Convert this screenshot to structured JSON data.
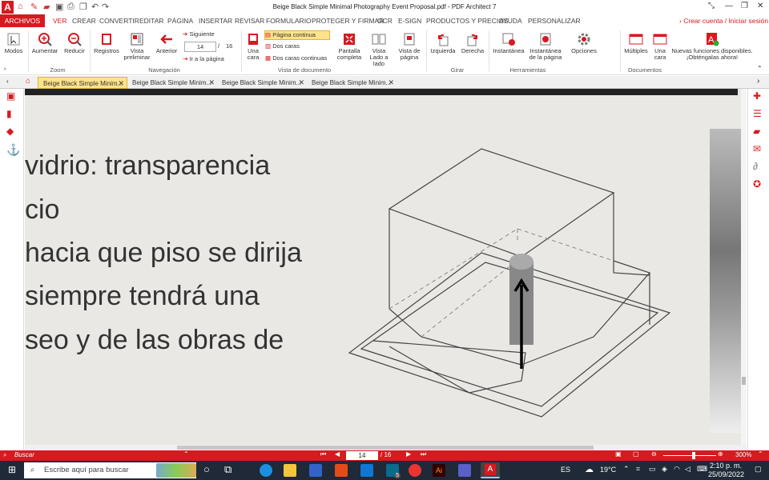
{
  "window": {
    "title": "Beige Black Simple Minimal Photography Event Proposal.pdf   -   PDF Architect 7"
  },
  "menu": {
    "archivos": "ARCHIVOS",
    "items": [
      "VER",
      "CREAR",
      "CONVERTIR",
      "EDITAR",
      "PÁGINA",
      "INSERTAR",
      "REVISAR",
      "FORMULARIO",
      "PROTEGER Y FIRMAR",
      "OCR",
      "E-SIGN",
      "PRODUCTOS Y PRECIOS",
      "AYUDA",
      "PERSONALIZAR"
    ],
    "account": "Crear cuenta / Iniciar sesión"
  },
  "ribbon": {
    "modos": "Modos",
    "aumentar": "Aumentar",
    "reducir": "Reducir",
    "zoom_group": "Zoom",
    "registros": "Registros",
    "vista_preliminar": "Vista preliminar",
    "anterior": "Anterior",
    "siguiente": "Siguiente",
    "page_value": "14",
    "page_sep": "/",
    "page_total": "16",
    "ir_pagina": "Ir a la página",
    "nav_group": "Navegación",
    "una_cara": "Una cara",
    "pagina_continua": "Página continua",
    "dos_caras": "Dos caras",
    "dos_caras_continuas": "Dos caras continuas",
    "pantalla_completa": "Pantalla completa",
    "vista_lado": "Vista Lado a lado",
    "vista_pagina": "Vista de página",
    "vista_group": "Vista de documento",
    "izquierda": "Izquierda",
    "derecha": "Derecha",
    "girar_group": "Girar",
    "instantanea": "Instantánea",
    "instantanea_pagina": "Instantánea de la página",
    "opciones": "Opciones",
    "herramientas_group": "Herramientas",
    "multiples": "Múltiples",
    "una_cara2": "Una cara",
    "nuevas": "Nuevas funciones disponibles. ¡Obténgalas ahora!",
    "documentos_group": "Documentos"
  },
  "tabs": [
    "Beige Black Simple Minim...",
    "Beige Black Simple Minim...",
    "Beige Black Simple Minim...",
    "Beige Black Simple Minim..."
  ],
  "document": {
    "lines": [
      "vidrio: transparencia",
      "cio",
      "hacia que piso se dirija",
      "siempre tendrá una",
      "seo y de las obras de"
    ]
  },
  "status": {
    "search": "Buscar",
    "page_value": "14",
    "page_total": "/ 16",
    "zoom": "300%"
  },
  "taskbar": {
    "search_placeholder": "Escribe aquí para buscar",
    "lang": "ES",
    "temp": "19°C",
    "time": "2:10 p. m.",
    "date": "25/09/2022",
    "badge": "5"
  },
  "colors": {
    "accent": "#d71920",
    "tab_active": "#ffe38a",
    "doc_bg": "#e9e8e4"
  }
}
